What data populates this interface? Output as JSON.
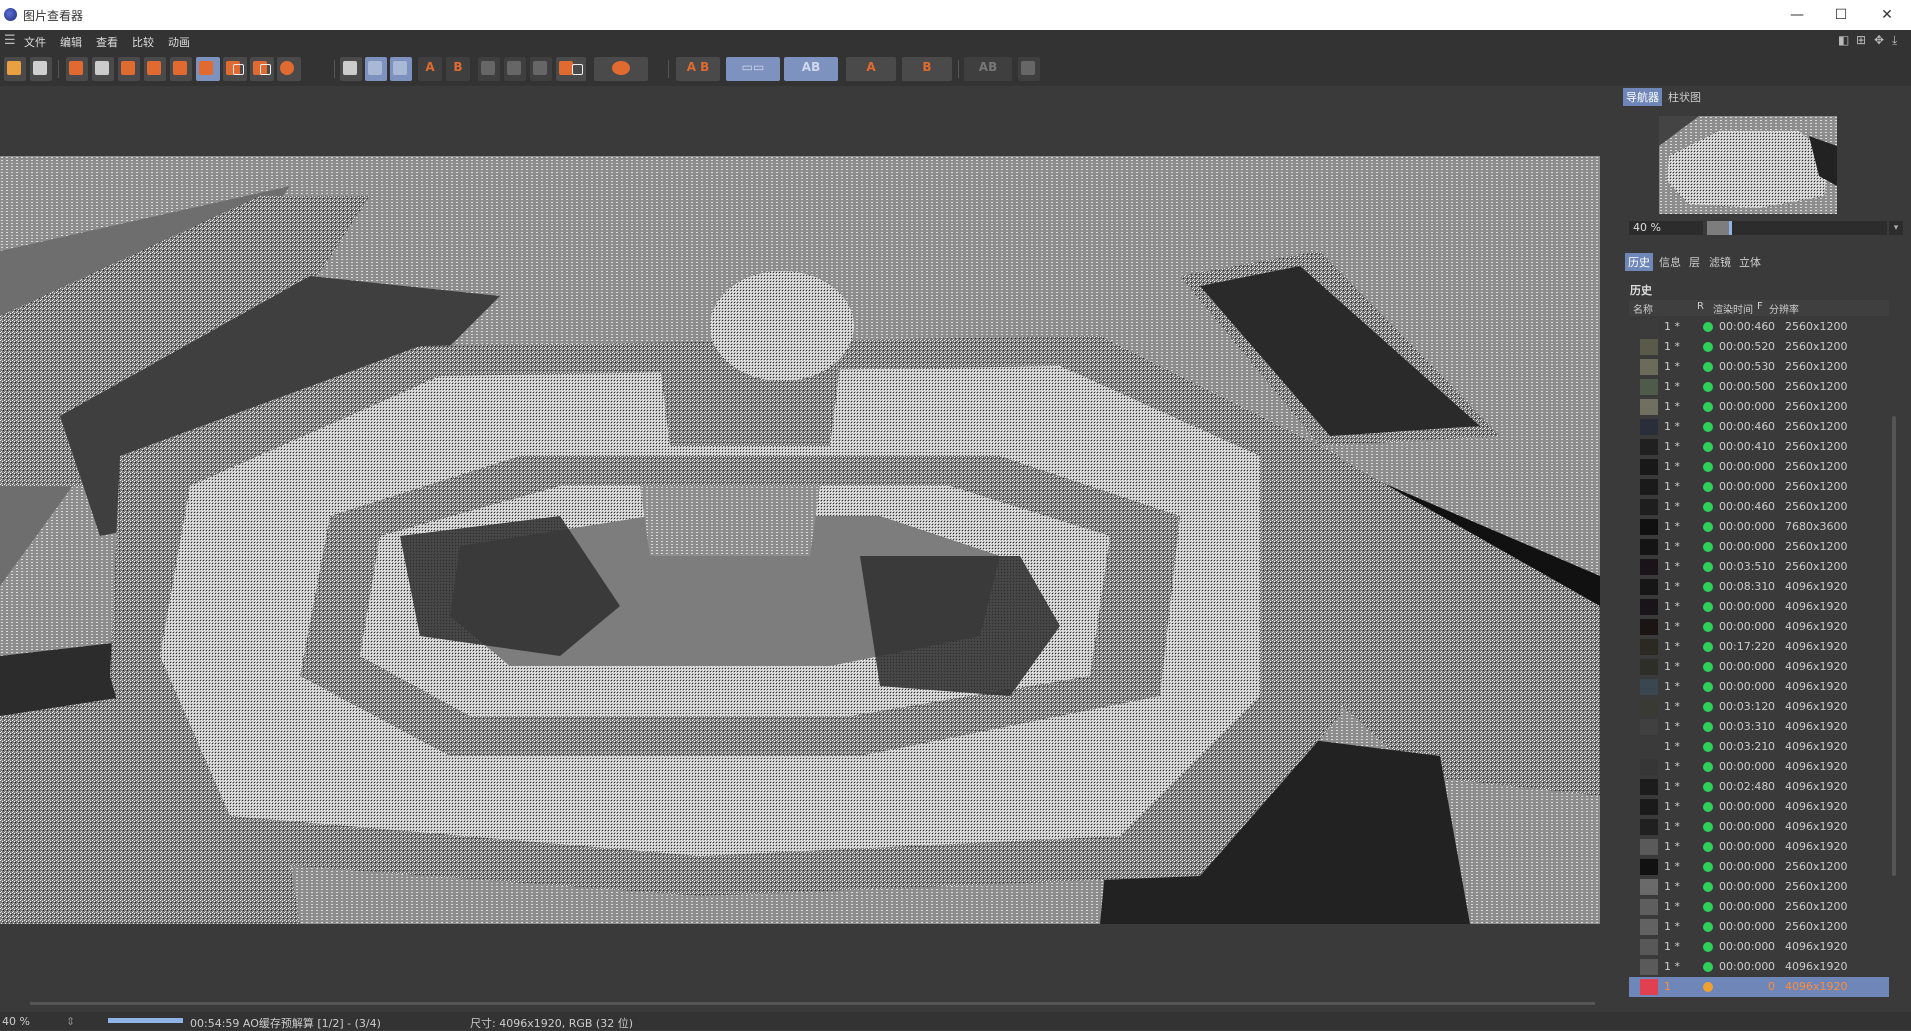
{
  "window": {
    "title": "图片查看器"
  },
  "menu": {
    "items": [
      "文件",
      "编辑",
      "查看",
      "比较",
      "动画"
    ]
  },
  "toolbar": {
    "a_label": "A",
    "b_label": "B",
    "ab_label": "A B"
  },
  "navigator": {
    "tabs": [
      "导航器",
      "柱状图"
    ],
    "zoom": "40 %",
    "zoom_level": 0.13
  },
  "panel": {
    "tabs": [
      "历史",
      "信息",
      "层",
      "滤镜",
      "立体"
    ],
    "section_title": "历史",
    "columns": {
      "name": "名称",
      "r": "R",
      "time": "渲染时间",
      "f": "F",
      "res": "分辨率"
    },
    "rows": [
      {
        "idx": "1 *",
        "time": "00:00:46",
        "f": "0",
        "res": "2560x1200",
        "status": "green",
        "thumb": "#3b3b3b"
      },
      {
        "idx": "1 *",
        "time": "00:00:52",
        "f": "0",
        "res": "2560x1200",
        "status": "green",
        "thumb": "#5a5a4a"
      },
      {
        "idx": "1 *",
        "time": "00:00:53",
        "f": "0",
        "res": "2560x1200",
        "status": "green",
        "thumb": "#6b6b5a"
      },
      {
        "idx": "1 *",
        "time": "00:00:50",
        "f": "0",
        "res": "2560x1200",
        "status": "green",
        "thumb": "#4e5a4a"
      },
      {
        "idx": "1 *",
        "time": "00:00:00",
        "f": "0",
        "res": "2560x1200",
        "status": "green",
        "thumb": "#707060"
      },
      {
        "idx": "1 *",
        "time": "00:00:46",
        "f": "0",
        "res": "2560x1200",
        "status": "green",
        "thumb": "#2a2e3a"
      },
      {
        "idx": "1 *",
        "time": "00:00:41",
        "f": "0",
        "res": "2560x1200",
        "status": "green",
        "thumb": "#202020"
      },
      {
        "idx": "1 *",
        "time": "00:00:00",
        "f": "0",
        "res": "2560x1200",
        "status": "green",
        "thumb": "#181818"
      },
      {
        "idx": "1 *",
        "time": "00:00:00",
        "f": "0",
        "res": "2560x1200",
        "status": "green",
        "thumb": "#1a1a1a"
      },
      {
        "idx": "1 *",
        "time": "00:00:46",
        "f": "0",
        "res": "2560x1200",
        "status": "green",
        "thumb": "#1e1e1e"
      },
      {
        "idx": "1 *",
        "time": "00:00:00",
        "f": "0",
        "res": "7680x3600",
        "status": "green",
        "thumb": "#101010"
      },
      {
        "idx": "1 *",
        "time": "00:00:00",
        "f": "0",
        "res": "2560x1200",
        "status": "green",
        "thumb": "#141414"
      },
      {
        "idx": "1 *",
        "time": "00:03:51",
        "f": "0",
        "res": "2560x1200",
        "status": "green",
        "thumb": "#1a1418"
      },
      {
        "idx": "1 *",
        "time": "00:08:31",
        "f": "0",
        "res": "4096x1920",
        "status": "green",
        "thumb": "#161616"
      },
      {
        "idx": "1 *",
        "time": "00:00:00",
        "f": "0",
        "res": "4096x1920",
        "status": "green",
        "thumb": "#181418"
      },
      {
        "idx": "1 *",
        "time": "00:00:00",
        "f": "0",
        "res": "4096x1920",
        "status": "green",
        "thumb": "#1a1414"
      },
      {
        "idx": "1 *",
        "time": "00:17:22",
        "f": "0",
        "res": "4096x1920",
        "status": "green",
        "thumb": "#2a2a22"
      },
      {
        "idx": "1 *",
        "time": "00:00:00",
        "f": "0",
        "res": "4096x1920",
        "status": "green",
        "thumb": "#2e2e28"
      },
      {
        "idx": "1 *",
        "time": "00:00:00",
        "f": "0",
        "res": "4096x1920",
        "status": "green",
        "thumb": "#3a4650"
      },
      {
        "idx": "1 *",
        "time": "00:03:12",
        "f": "0",
        "res": "4096x1920",
        "status": "green",
        "thumb": "#3a3a34"
      },
      {
        "idx": "1 *",
        "time": "00:03:31",
        "f": "0",
        "res": "4096x1920",
        "status": "green",
        "thumb": "#404040"
      },
      {
        "idx": "1 *",
        "time": "00:03:21",
        "f": "0",
        "res": "4096x1920",
        "status": "green",
        "thumb": "#3a3a3a"
      },
      {
        "idx": "1 *",
        "time": "00:00:00",
        "f": "0",
        "res": "4096x1920",
        "status": "green",
        "thumb": "#363636"
      },
      {
        "idx": "1 *",
        "time": "00:02:48",
        "f": "0",
        "res": "4096x1920",
        "status": "green",
        "thumb": "#1c1c1c"
      },
      {
        "idx": "1 *",
        "time": "00:00:00",
        "f": "0",
        "res": "4096x1920",
        "status": "green",
        "thumb": "#1a1a1a"
      },
      {
        "idx": "1 *",
        "time": "00:00:00",
        "f": "0",
        "res": "4096x1920",
        "status": "green",
        "thumb": "#202020"
      },
      {
        "idx": "1 *",
        "time": "00:00:00",
        "f": "0",
        "res": "4096x1920",
        "status": "green",
        "thumb": "#5a5a5a"
      },
      {
        "idx": "1 *",
        "time": "00:00:00",
        "f": "0",
        "res": "2560x1200",
        "status": "green",
        "thumb": "#111111"
      },
      {
        "idx": "1 *",
        "time": "00:00:00",
        "f": "0",
        "res": "2560x1200",
        "status": "green",
        "thumb": "#6a6a6a"
      },
      {
        "idx": "1 *",
        "time": "00:00:00",
        "f": "0",
        "res": "2560x1200",
        "status": "green",
        "thumb": "#5e5e5e"
      },
      {
        "idx": "1 *",
        "time": "00:00:00",
        "f": "0",
        "res": "2560x1200",
        "status": "green",
        "thumb": "#626262"
      },
      {
        "idx": "1 *",
        "time": "00:00:00",
        "f": "0",
        "res": "4096x1920",
        "status": "green",
        "thumb": "#585858"
      },
      {
        "idx": "1 *",
        "time": "00:00:00",
        "f": "0",
        "res": "4096x1920",
        "status": "green",
        "thumb": "#5a5a5a"
      },
      {
        "idx": "1",
        "time": "",
        "f": "0",
        "res": "4096x1920",
        "status": "orange",
        "thumb": "#e04050",
        "selected": true
      }
    ]
  },
  "status": {
    "zoom": "40 %",
    "progress_text": "00:54:59 AO缓存预解算 [1/2] - (3/4)",
    "progress": 1.0,
    "size_info": "尺寸: 4096x1920, RGB (32 位)"
  },
  "colors": {
    "accent": "#6e86b8",
    "status_green": "#2fd05a",
    "status_orange": "#f0a030",
    "toolbar_orange": "#e06a30"
  }
}
